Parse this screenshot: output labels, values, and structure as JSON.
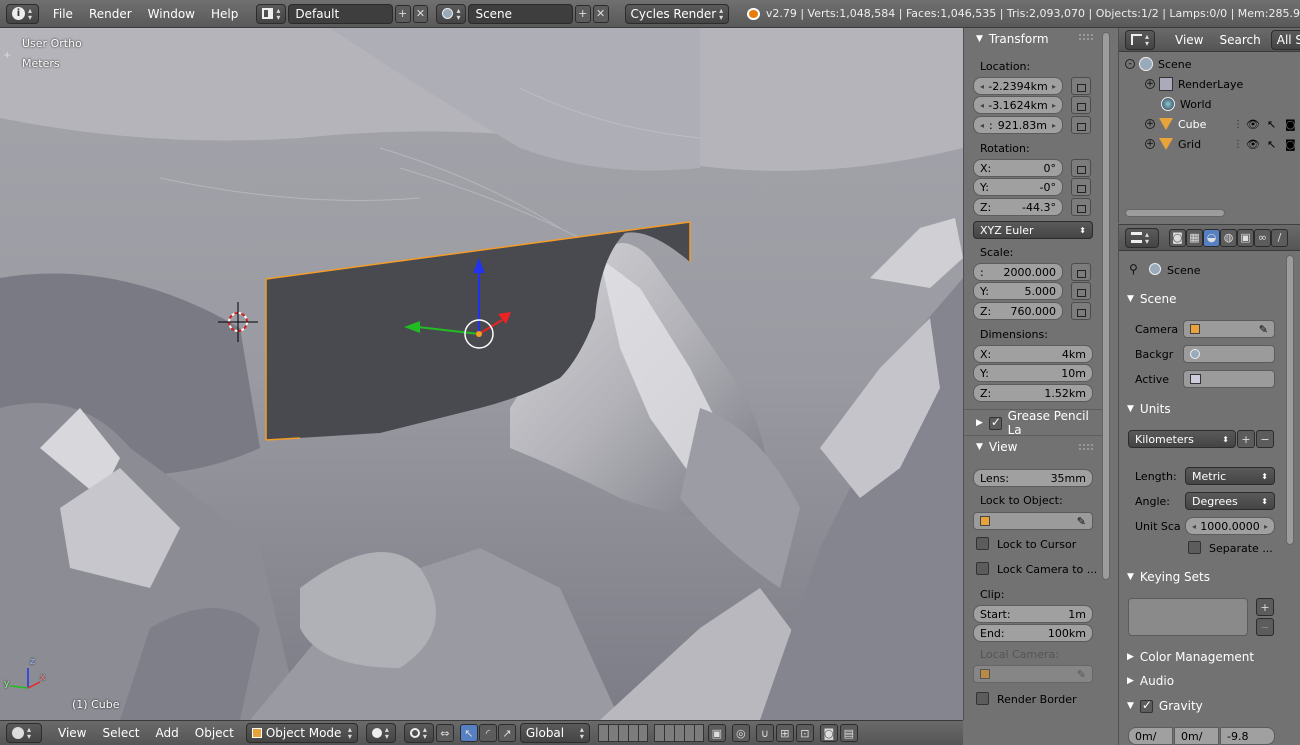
{
  "topbar": {
    "menus": [
      "File",
      "Render",
      "Window",
      "Help"
    ],
    "layout": "Default",
    "scene": "Scene",
    "engine": "Cycles Render",
    "stats": "v2.79 | Verts:1,048,584 | Faces:1,046,535 | Tris:2,093,070 | Objects:1/2 | Lamps:0/0 | Mem:285.9"
  },
  "viewport": {
    "view_name": "User Ortho",
    "units": "Meters",
    "object_label": "(1) Cube"
  },
  "bottombar": {
    "menus": [
      "View",
      "Select",
      "Add",
      "Object"
    ],
    "mode": "Object Mode",
    "orientation": "Global"
  },
  "npanel": {
    "transform_title": "Transform",
    "location_label": "Location:",
    "location": [
      "-2.2394km",
      "-3.1624km",
      "921.83m"
    ],
    "location_prefix": [
      "",
      "",
      " : "
    ],
    "rotation_label": "Rotation:",
    "rotation": [
      {
        "axis": "X:",
        "val": "0°"
      },
      {
        "axis": "Y:",
        "val": "-0°"
      },
      {
        "axis": "Z:",
        "val": "-44.3°"
      }
    ],
    "rotation_mode": "XYZ Euler",
    "scale_label": "Scale:",
    "scale": [
      {
        "axis": ":",
        "val": "2000.000"
      },
      {
        "axis": "Y:",
        "val": "5.000"
      },
      {
        "axis": "Z:",
        "val": "760.000"
      }
    ],
    "dimensions_label": "Dimensions:",
    "dimensions": [
      {
        "axis": "X:",
        "val": "4km"
      },
      {
        "axis": "Y:",
        "val": "10m"
      },
      {
        "axis": "Z:",
        "val": "1.52km"
      }
    ],
    "grease_title": "Grease Pencil La",
    "view_title": "View",
    "lens": {
      "axis": "Lens:",
      "val": "35mm"
    },
    "lock_object_label": "Lock to Object:",
    "lock_cursor": "Lock to Cursor",
    "lock_camera": "Lock Camera to ...",
    "clip_label": "Clip:",
    "clip_start": {
      "axis": "Start:",
      "val": "1m"
    },
    "clip_end": {
      "axis": "End:",
      "val": "100km"
    },
    "local_camera": "Local Camera:",
    "render_border": "Render Border"
  },
  "outliner": {
    "menus": [
      "View",
      "Search"
    ],
    "filter": "All Sc",
    "items": [
      "Scene",
      "RenderLaye",
      "World",
      "Cube",
      "Grid"
    ]
  },
  "props": {
    "breadcrumb": "Scene",
    "scene_title": "Scene",
    "camera_label": "Camera",
    "background_label": "Backgr",
    "active_label": "Active",
    "units_title": "Units",
    "unit_preset": "Kilometers",
    "length_label": "Length:",
    "length_val": "Metric",
    "angle_label": "Angle:",
    "angle_val": "Degrees",
    "unit_scale_label": "Unit Sca",
    "unit_scale_val": "1000.0000",
    "separate": "Separate ...",
    "keying_title": "Keying Sets",
    "color_mgmt": "Color Management",
    "audio": "Audio",
    "gravity": "Gravity",
    "gravity_vals": [
      "0m/",
      "0m/",
      "-9.8"
    ]
  }
}
